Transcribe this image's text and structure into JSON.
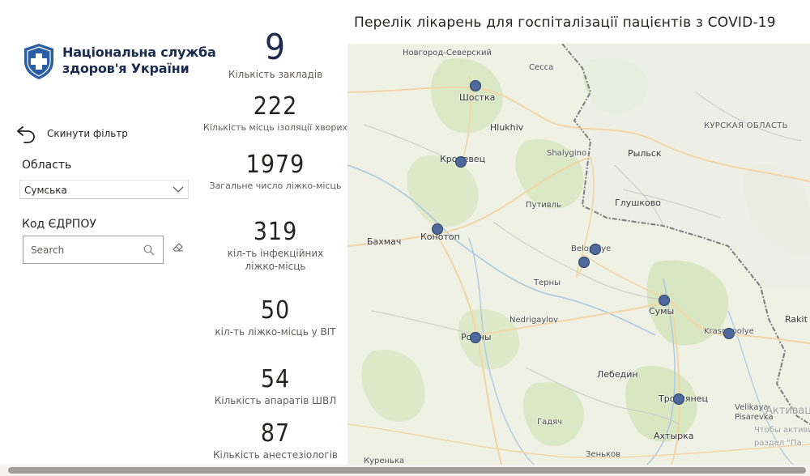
{
  "logo": {
    "line1": "Національна служба",
    "line2": "здоров'я України",
    "brand_color": "#2a5fa5"
  },
  "filters": {
    "reset_label": "Скинути фільтр",
    "region_title": "Область",
    "region_value": "Сумська",
    "code_title": "Код ЄДРПОУ",
    "search_placeholder": "Search"
  },
  "kpis": [
    {
      "value": "9",
      "label": "Кількість закладів"
    },
    {
      "value": "222",
      "label": "Кількість місць ізоляції хворих"
    },
    {
      "value": "1979",
      "label": "Загальне число ліжко-місць"
    },
    {
      "value": "319",
      "label_line1": "кіл-ть інфекційних",
      "label_line2": "ліжко-місць"
    },
    {
      "value": "50",
      "label": "кіл-ть ліжко-місць у ВІТ"
    },
    {
      "value": "54",
      "label": "Кількість апаратів ШВЛ"
    },
    {
      "value": "87",
      "label": "Кількість анестезіологів"
    }
  ],
  "map": {
    "title": "Перелік лікарень для госпіталізації пацієнтів з COVID-19",
    "marker_color": "#4e6a9c",
    "labels": [
      "Новгород-Северский",
      "Сесса",
      "Шостка",
      "Hlukhiv",
      "КУРСКАЯ ОБЛАСТЬ",
      "Shalygino",
      "Рыльск",
      "Кролевец",
      "Глушково",
      "Путивль",
      "Бахмач",
      "Конотоп",
      "Belopolye",
      "Терны",
      "Сумы",
      "Nedrigaylov",
      "Ромны",
      "Krasnopolye",
      "Rakit",
      "Лебедин",
      "Тростянец",
      "Velikaya",
      "Pisarevka",
      "Гадяч",
      "Ахтырка",
      "Зеньков",
      "Куренька",
      "Активац",
      "Чтобы активиро",
      "раздел \"Па"
    ]
  }
}
